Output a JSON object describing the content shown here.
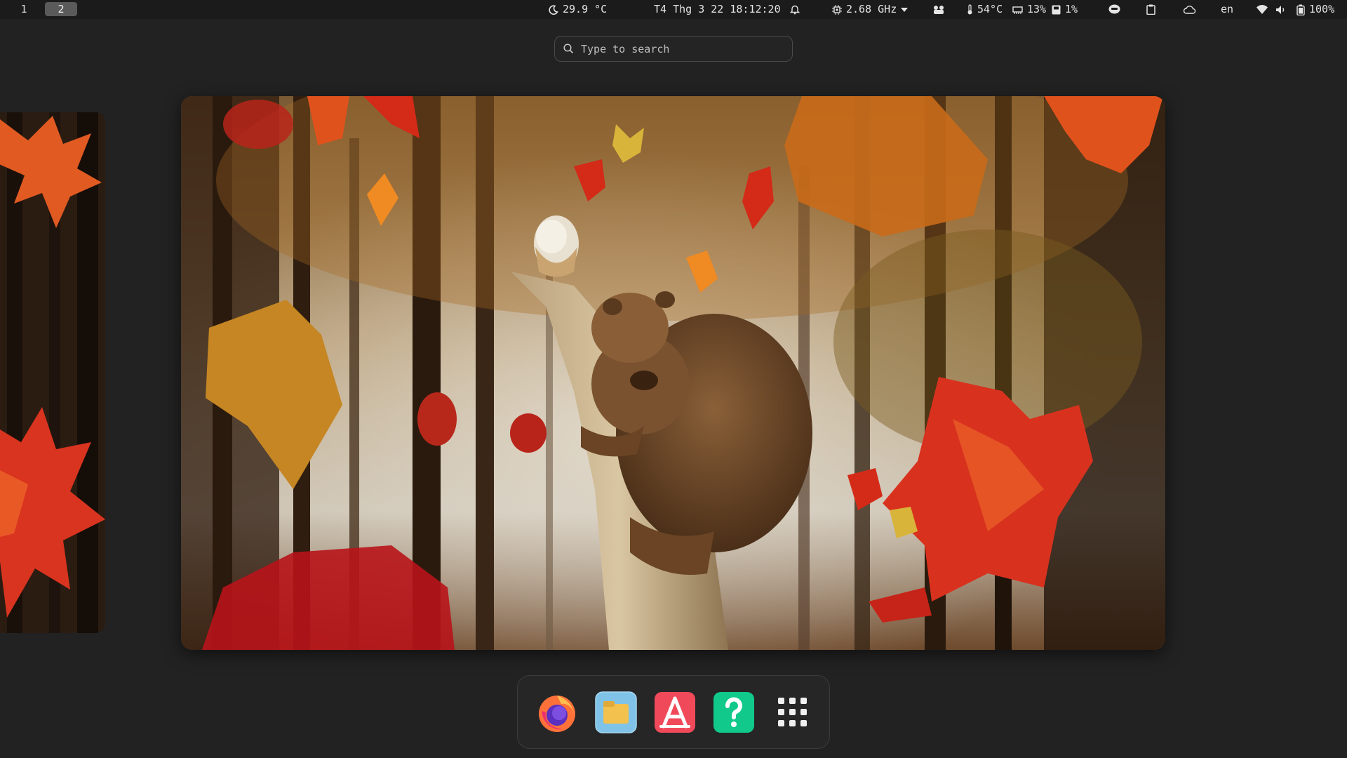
{
  "topbar": {
    "workspaces": [
      {
        "label": "1",
        "active": false
      },
      {
        "label": "2",
        "active": true
      }
    ],
    "weather": {
      "icon": "moon-icon",
      "temp": "29.9 °C"
    },
    "clock": "T4 Thg 3 22 18:12:20",
    "notifications": {
      "icon": "bell-icon"
    },
    "cpu": {
      "icon": "cpu-icon",
      "freq": "2.68 GHz"
    },
    "gpu": {
      "icon": "fan-icon"
    },
    "temperature": {
      "icon": "thermometer-icon",
      "value": "54°C"
    },
    "memory": {
      "icon": "memory-icon",
      "value": "13%"
    },
    "storage": {
      "icon": "disk-icon",
      "value": "1%"
    },
    "tray": [
      "chat-bubble-icon",
      "clipboard-icon",
      "cloud-icon"
    ],
    "language": "en",
    "wifi": {
      "icon": "wifi-icon"
    },
    "volume": {
      "icon": "speaker-icon"
    },
    "battery": {
      "icon": "battery-icon",
      "value": "100%"
    }
  },
  "search": {
    "placeholder": "Type to search"
  },
  "dock": {
    "apps": [
      {
        "name": "Firefox",
        "icon": "firefox-icon"
      },
      {
        "name": "Files",
        "icon": "files-icon"
      },
      {
        "name": "App Store",
        "icon": "app-store-icon"
      },
      {
        "name": "Help",
        "icon": "help-icon"
      },
      {
        "name": "Show Applications",
        "icon": "app-grid-icon"
      }
    ]
  },
  "colors": {
    "background": "#222222",
    "topbar": "#1b1b1b",
    "leaf_red": "#d8321e",
    "leaf_orange": "#e8731f",
    "leaf_gold": "#d99a2a"
  }
}
